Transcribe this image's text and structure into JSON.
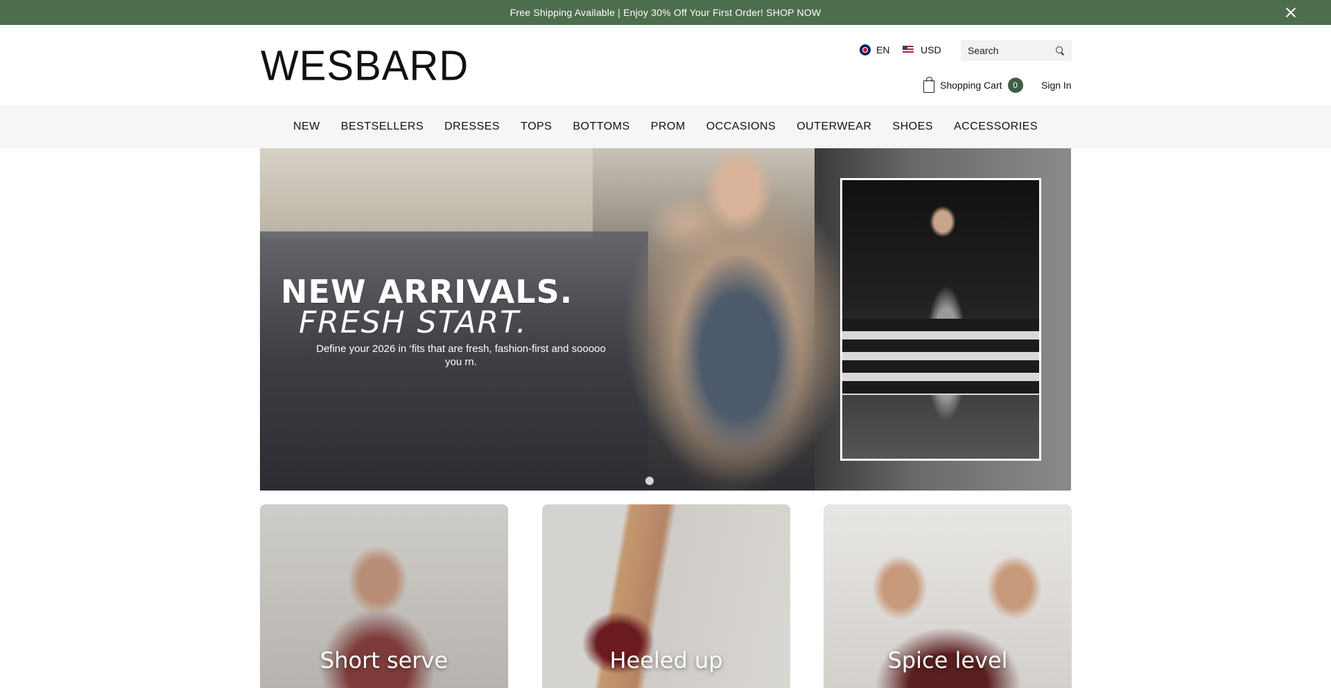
{
  "announcement": {
    "text": "Free Shipping Available | Enjoy 30% Off Your First Order! SHOP NOW",
    "close_icon": "close-icon"
  },
  "header": {
    "logo": "WESBARD",
    "language": "EN",
    "currency": "USD",
    "search_placeholder": "Search",
    "cart_label": "Shopping Cart",
    "cart_count": "0",
    "signin_label": "Sign In"
  },
  "nav": {
    "items": [
      "NEW",
      "BESTSELLERS",
      "DRESSES",
      "TOPS",
      "BOTTOMS",
      "PROM",
      "OCCASIONS",
      "OUTERWEAR",
      "SHOES",
      "ACCESSORIES"
    ]
  },
  "hero": {
    "headline": "NEW ARRIVALS.",
    "subheadline": "FRESH START.",
    "description": "Define your 2026 in ‘fits that are fresh, fashion-first and sooooo you rn."
  },
  "cards": [
    {
      "label": "Short serve"
    },
    {
      "label": "Heeled up"
    },
    {
      "label": "Spice level"
    }
  ],
  "colors": {
    "announcement_bg": "#4d6e4c",
    "cart_badge": "#3e5d42",
    "nav_bg": "#f6f6f6"
  }
}
